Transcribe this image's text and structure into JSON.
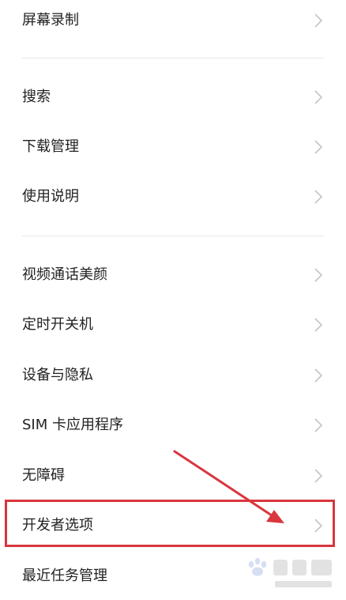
{
  "settings": {
    "items": [
      {
        "label": "屏幕录制"
      },
      {
        "label": "搜索"
      },
      {
        "label": "下载管理"
      },
      {
        "label": "使用说明"
      },
      {
        "label": "视频通话美颜"
      },
      {
        "label": "定时开关机"
      },
      {
        "label": "设备与隐私"
      },
      {
        "label": "SIM 卡应用程序"
      },
      {
        "label": "无障碍"
      },
      {
        "label": "开发者选项"
      },
      {
        "label": "最近任务管理"
      }
    ]
  },
  "annotation": {
    "highlight_color": "#d9363e",
    "highlighted_item": "开发者选项"
  },
  "colors": {
    "text": "#222222",
    "chevron": "#c4c4c4",
    "divider": "#e8e8e8",
    "background": "#ffffff"
  },
  "watermark": {
    "logo": "baidu-jingyan-logo"
  }
}
